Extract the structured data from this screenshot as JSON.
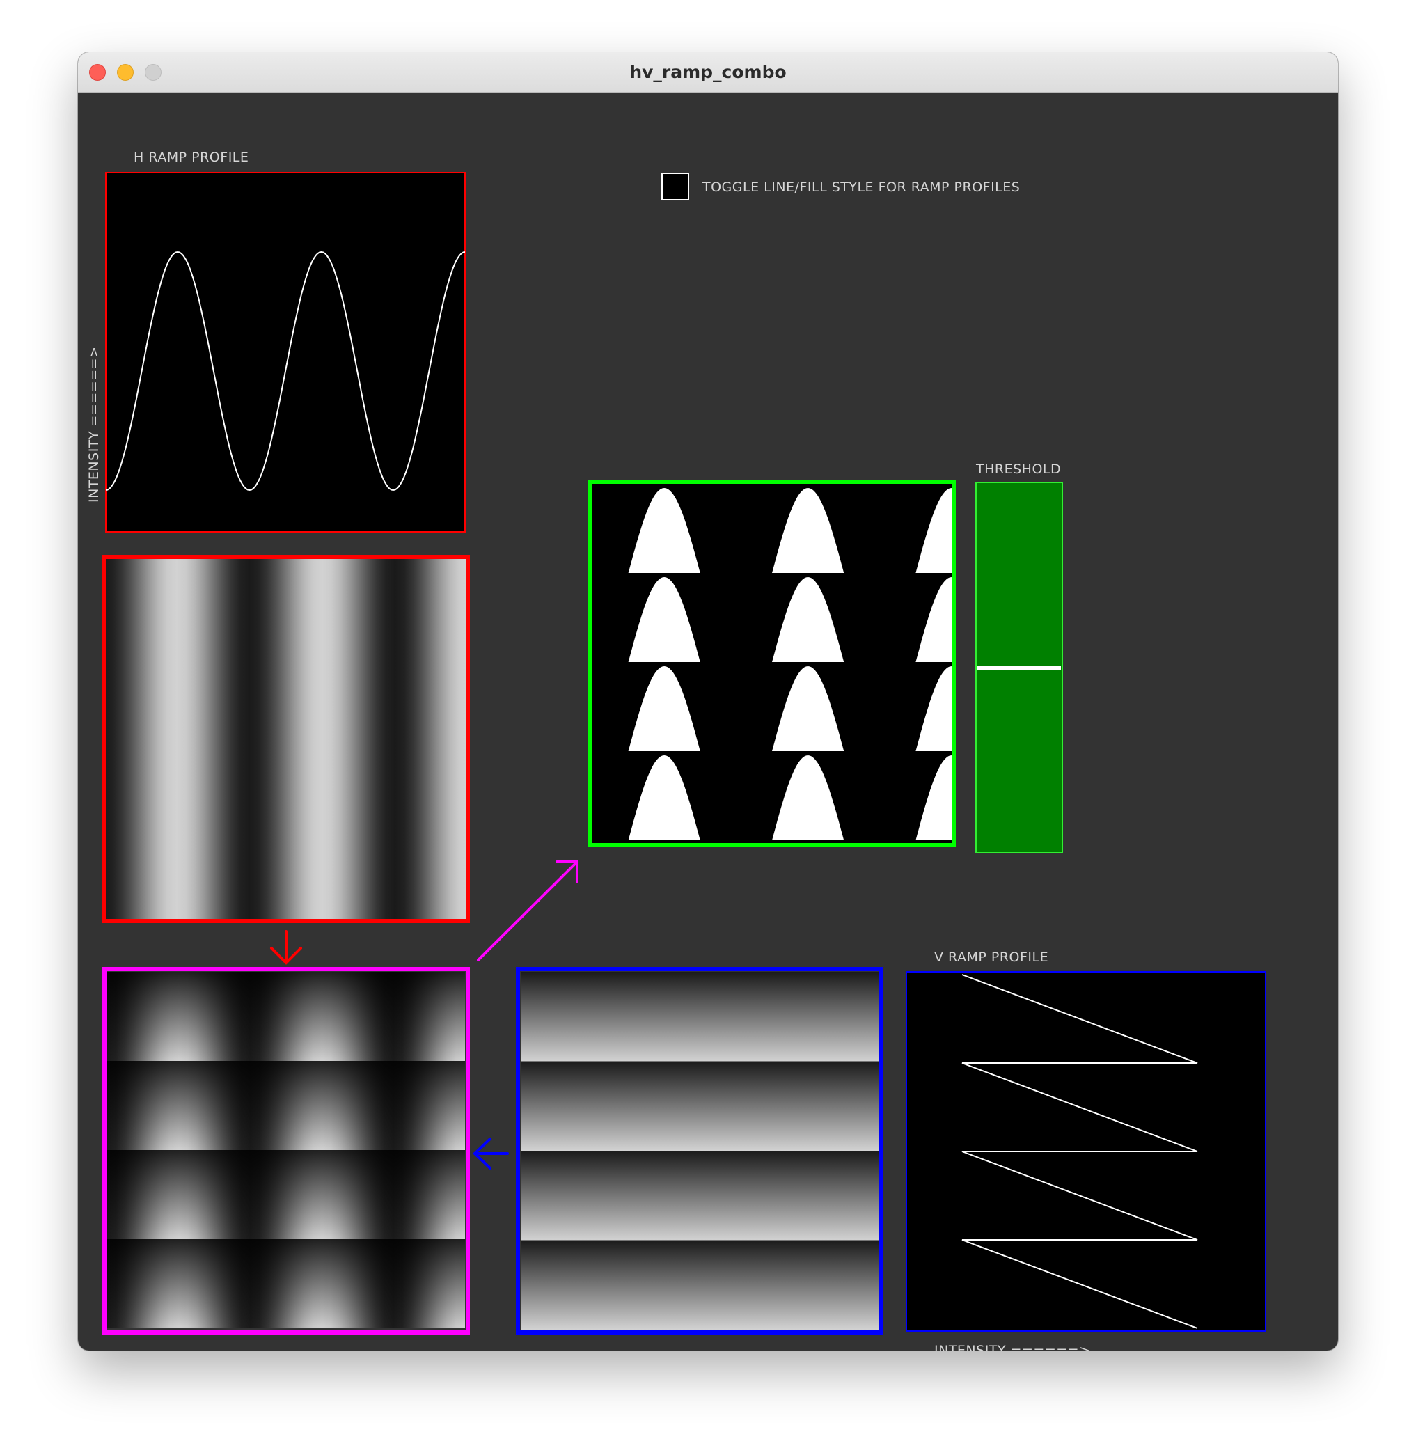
{
  "window": {
    "title": "hv_ramp_combo"
  },
  "labels": {
    "h_ramp_profile": "H RAMP PROFILE",
    "v_ramp_profile": "V RAMP PROFILE",
    "threshold": "THRESHOLD",
    "intensity_vertical": "INTENSITY ======>",
    "intensity_horizontal": "INTENSITY ======>"
  },
  "toggle": {
    "label": "TOGGLE LINE/FILL STYLE FOR RAMP PROFILES",
    "checked": false
  },
  "colors": {
    "background": "#333333",
    "h_ramp": "#ff0000",
    "v_ramp": "#0000ff",
    "combo": "#ff00ff",
    "threshold_result": "#00ff00",
    "threshold_slider": "#008000"
  },
  "h_profile": {
    "waveform": "cosine",
    "cycles": 2.5,
    "min": 0.0,
    "max": 1.0
  },
  "v_profile": {
    "waveform": "sawtooth",
    "cycles": 4
  },
  "threshold": {
    "value": 0.5
  }
}
